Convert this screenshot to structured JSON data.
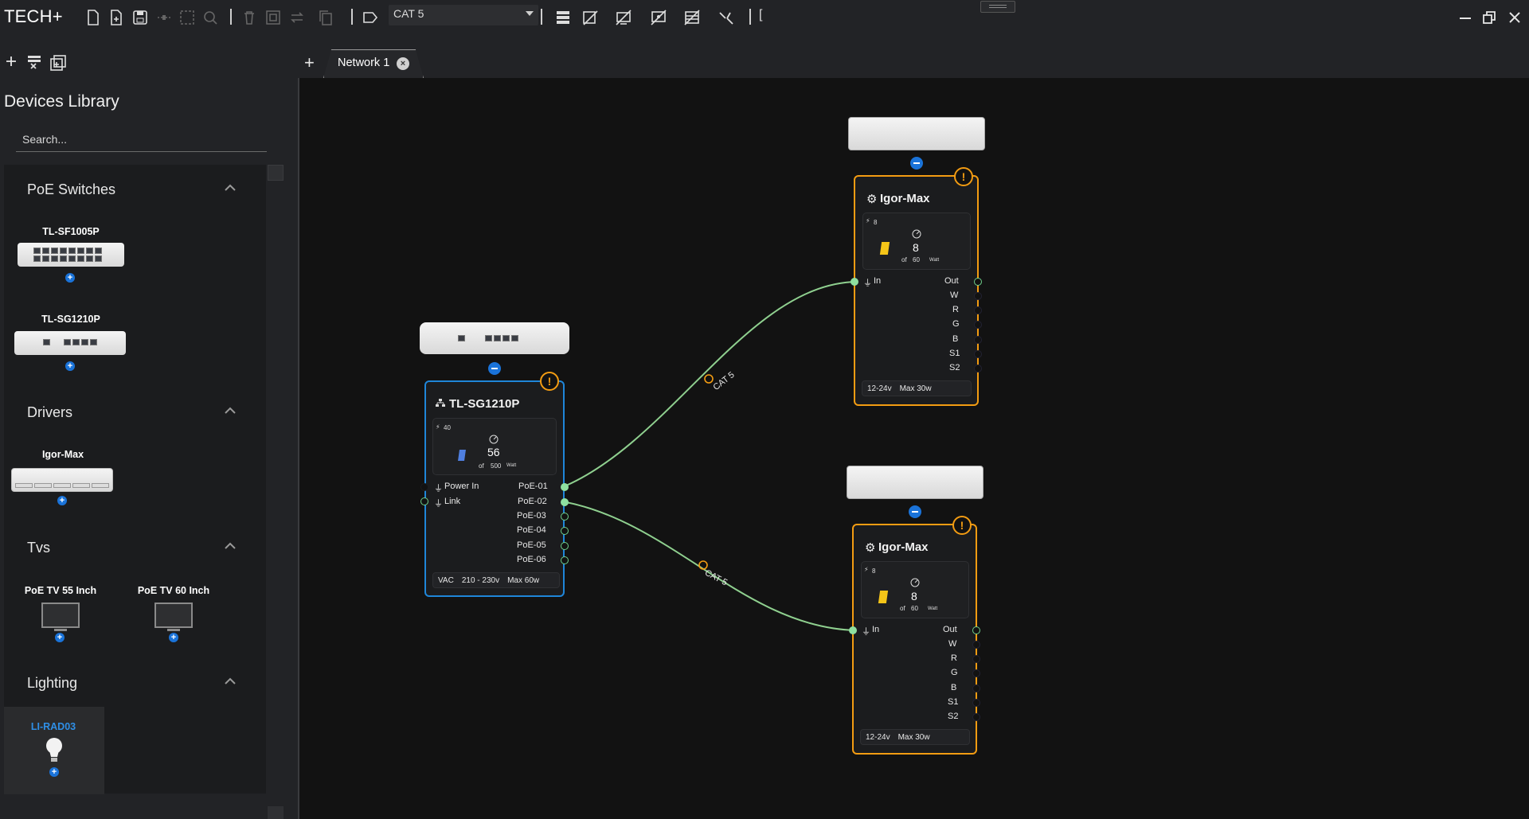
{
  "app": {
    "title": "TECH+"
  },
  "toolbar": {
    "cable_type": "CAT 5",
    "partial_label": "["
  },
  "sidebar": {
    "title": "Devices Library",
    "search_placeholder": "Search...",
    "categories": [
      {
        "name": "PoE Switches",
        "devices": [
          "TL-SF1005P",
          "TL-SG1210P"
        ]
      },
      {
        "name": "Drivers",
        "devices": [
          "Igor-Max"
        ]
      },
      {
        "name": "Tvs",
        "devices": [
          "PoE TV 55 Inch",
          "PoE TV 60 Inch"
        ]
      },
      {
        "name": "Lighting",
        "devices": [
          "LI-RAD03"
        ]
      }
    ]
  },
  "tabs": [
    {
      "label": "Network 1",
      "active": true
    }
  ],
  "canvas": {
    "switch": {
      "name": "TL-SG1210P",
      "power_icon_value": "40",
      "usage": "56",
      "of": "of",
      "capacity": "500",
      "unit": "Watt",
      "inputs": [
        "Power In",
        "Link"
      ],
      "ports": [
        "PoE-01",
        "PoE-02",
        "PoE-03",
        "PoE-04",
        "PoE-05",
        "PoE-06"
      ],
      "footer": {
        "power": "VAC",
        "voltage": "210 - 230v",
        "max": "Max 60w"
      }
    },
    "drivers": [
      {
        "name": "Igor-Max",
        "power_icon_value": "8",
        "usage": "8",
        "of": "of",
        "capacity": "60",
        "unit": "Watt",
        "input": "In",
        "output": "Out",
        "channels": [
          "W",
          "R",
          "G",
          "B",
          "S1",
          "S2"
        ],
        "footer": {
          "voltage": "12-24v",
          "max": "Max 30w"
        }
      },
      {
        "name": "Igor-Max",
        "power_icon_value": "8",
        "usage": "8",
        "of": "of",
        "capacity": "60",
        "unit": "Watt",
        "input": "In",
        "output": "Out",
        "channels": [
          "W",
          "R",
          "G",
          "B",
          "S1",
          "S2"
        ],
        "footer": {
          "voltage": "12-24v",
          "max": "Max 30w"
        }
      }
    ],
    "connections": [
      {
        "from": "PoE-01",
        "to": "Igor-Max 1 In",
        "label": "CAT 5"
      },
      {
        "from": "PoE-02",
        "to": "Igor-Max 2 In",
        "label": "CAT 5"
      }
    ],
    "colors": {
      "wire": "#8fd08f",
      "switch_border": "#1f86d9",
      "driver_border": "#f39c12",
      "accent": "#1a73d9"
    }
  }
}
